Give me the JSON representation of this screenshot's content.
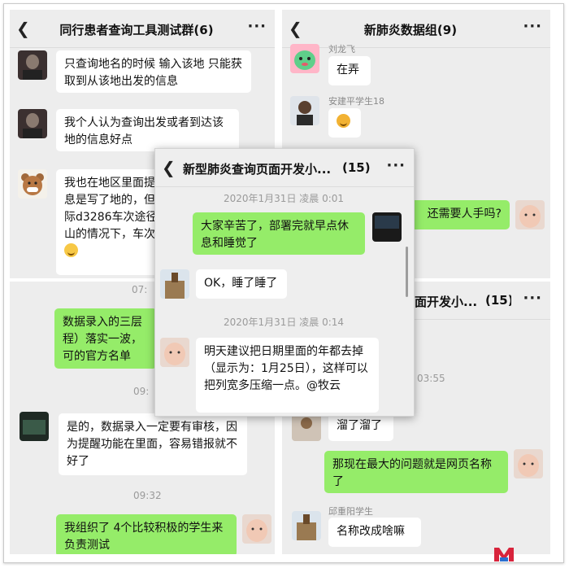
{
  "panel1": {
    "title": "同行患者查询工具测试群(6)",
    "more": "···",
    "messages": [
      "只查询地名的时候 输入该地 只能获取到从该地出发的信息",
      "我个人认为查询出发或者到达该地的信息好点",
      "我也在地区里面提示信息是写了地的，但是实际d3286车次途径庐山的情况下，车次的"
    ]
  },
  "panel2": {
    "title": "新肺炎数据组(9)",
    "more": "···",
    "sender1": "刘龙飞",
    "msg1": "在弄",
    "sender2": "安建平学生18",
    "msg3": "还需要人手吗?"
  },
  "panel3": {
    "time1": "07:",
    "msg1": "数据录入的三层程）落实一波，可的官方名单",
    "time2": "09:",
    "msg2": "是的，数据录入一定要有审核，因为提醒功能在里面，容易错报就不好了",
    "time3": "09:32",
    "msg3": "我组织了 4个比较积极的学生来负责测试"
  },
  "panel4": {
    "title": "面开发小...",
    "count": "(15)",
    "more": "···",
    "time": "03:55",
    "msg1": "溜了溜了",
    "msg2": "那现在最大的问题就是网页名称了",
    "sender": "邱重阳学生",
    "msg3": "名称改成啥嘛"
  },
  "panel5": {
    "title": "新型肺炎查询页面开发小...",
    "count": "(15)",
    "more": "···",
    "time1": "2020年1月31日 凌晨 0:01",
    "msg1": "大家辛苦了，部署完就早点休息和睡觉了",
    "msg2": "OK，睡了睡了",
    "time2": "2020年1月31日 凌晨 0:14",
    "msg3": "明天建议把日期里面的年都去掉（显示为：1月25日），这样可以把列宽多压缩一点。@牧云"
  },
  "icons": {
    "back": "chevron-left-icon",
    "more": "more-dots-icon",
    "laugh_emoji": "laughing-emoji-icon",
    "shock_emoji": "shocked-emoji-icon"
  },
  "colors": {
    "sent_bubble": "#95ec69",
    "received_bubble": "#ffffff",
    "chat_background": "#ededed"
  }
}
